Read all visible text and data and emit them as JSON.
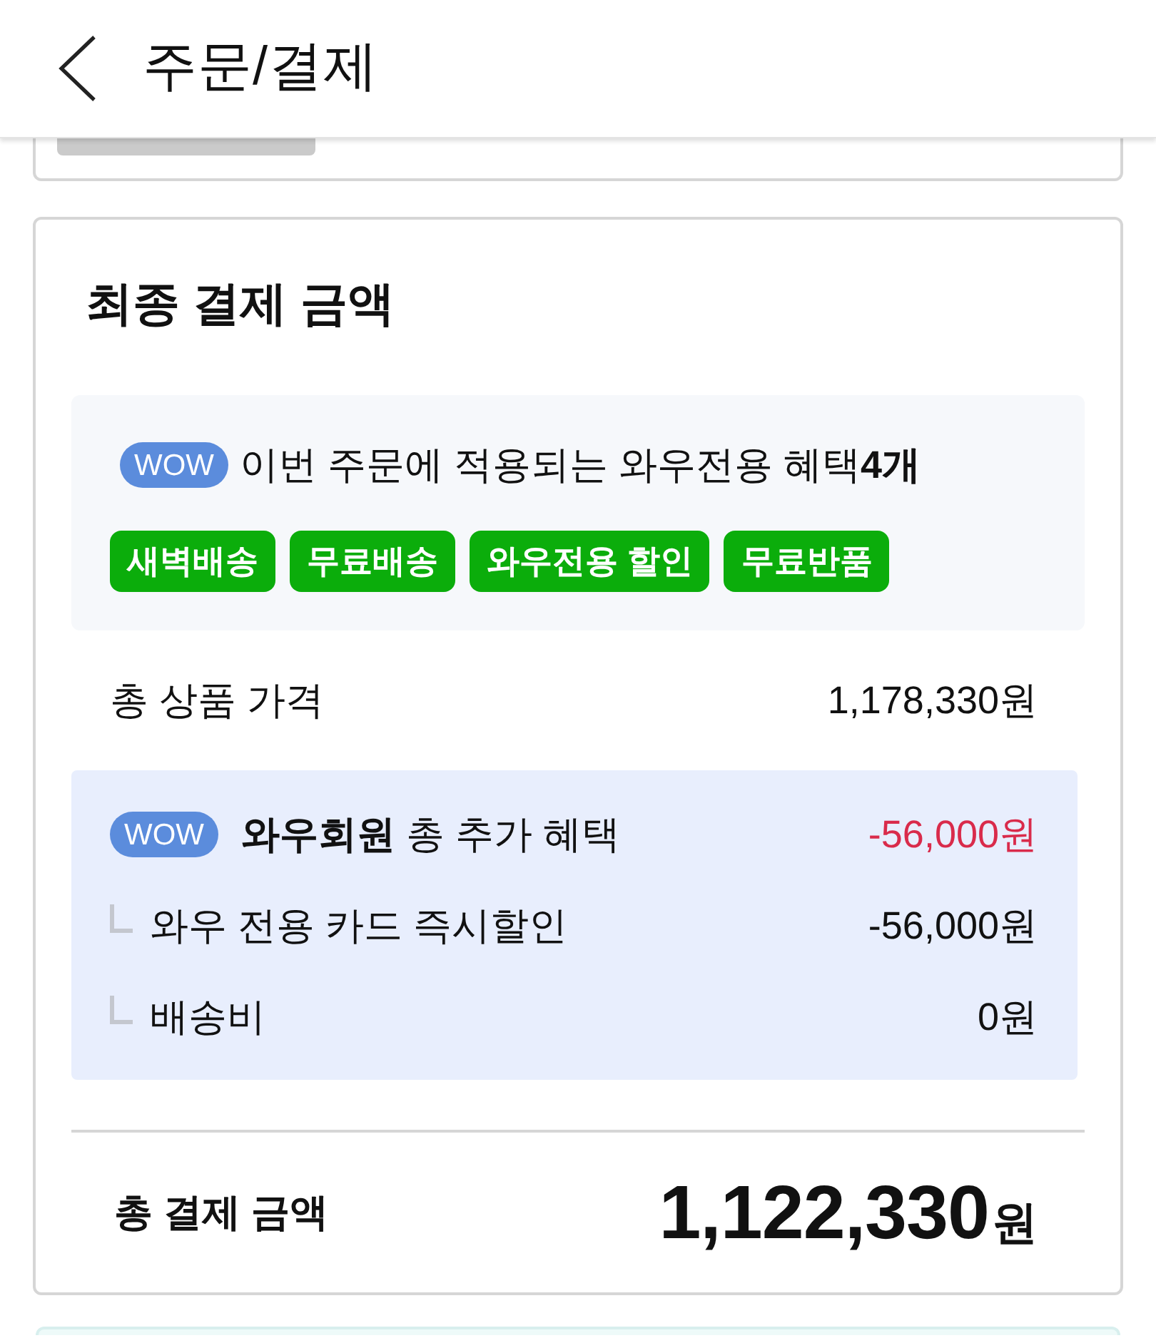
{
  "header": {
    "title": "주문/결제"
  },
  "payment_summary": {
    "title": "최종 결제 금액",
    "wow_benefits": {
      "badge": "WOW",
      "text": "이번 주문에 적용되는 와우전용 혜택**4개**",
      "tags": [
        "새벽배송",
        "무료배송",
        "와우전용 할인",
        "무료반품"
      ]
    },
    "product_total": {
      "label": "총 상품 가격",
      "amount": "1,178,330원"
    },
    "member_benefits": {
      "badge": "WOW",
      "label": "**와우회원** 총 추가 혜택",
      "amount": "-56,000원",
      "items": [
        {
          "label": "와우 전용 카드 즉시할인",
          "amount": "-56,000원"
        },
        {
          "label": "배송비",
          "amount": "0원"
        }
      ]
    },
    "total": {
      "label": "총 결제 금액",
      "amount": "1,122,330",
      "unit": "원"
    }
  }
}
